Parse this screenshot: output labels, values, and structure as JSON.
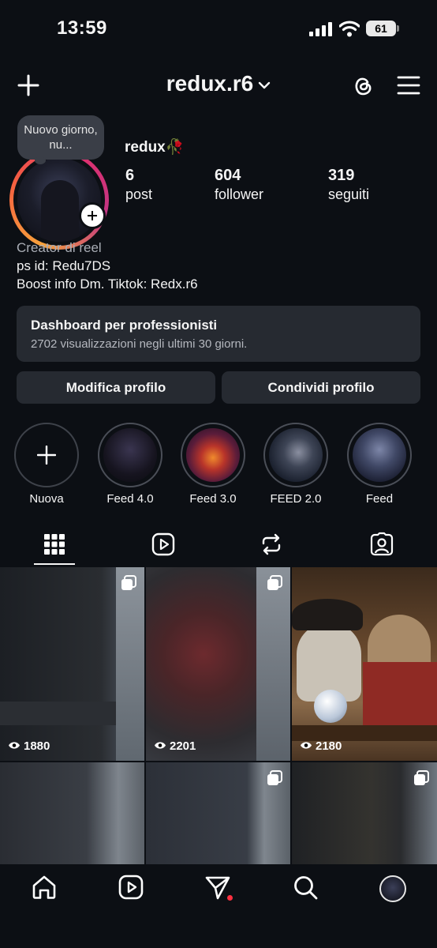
{
  "status_bar": {
    "time": "13:59",
    "battery": "61"
  },
  "header": {
    "username": "redux.r6"
  },
  "profile": {
    "note": "Nuovo giorno, nu...",
    "display_name": "redux🥀",
    "stats": [
      {
        "value": "6",
        "label": "post"
      },
      {
        "value": "604",
        "label": "follower"
      },
      {
        "value": "319",
        "label": "seguiti"
      }
    ],
    "bio": {
      "category": "Creator di reel",
      "line1": "ps id: Redu7DS",
      "line2": "Boost info Dm. Tiktok: Redx.r6"
    }
  },
  "dashboard": {
    "title": "Dashboard per professionisti",
    "subtitle": "2702 visualizzazioni negli ultimi 30 giorni."
  },
  "actions": {
    "edit": "Modifica profilo",
    "share": "Condividi profilo"
  },
  "highlights": [
    {
      "label": "Nuova"
    },
    {
      "label": "Feed 4.0"
    },
    {
      "label": "Feed 3.0"
    },
    {
      "label": "FEED 2.0"
    },
    {
      "label": "Feed"
    }
  ],
  "tabs": [
    "grid-icon",
    "reels-icon",
    "reposts-icon",
    "tagged-icon"
  ],
  "posts": [
    {
      "views": "1880"
    },
    {
      "views": "2201"
    },
    {
      "views": "2180"
    }
  ],
  "nav": [
    "home-icon",
    "reels-icon",
    "messages-icon",
    "search-icon",
    "profile-avatar"
  ],
  "colors": {
    "background": "#0c0f14",
    "card": "#262a31",
    "notification": "#ff3040"
  }
}
